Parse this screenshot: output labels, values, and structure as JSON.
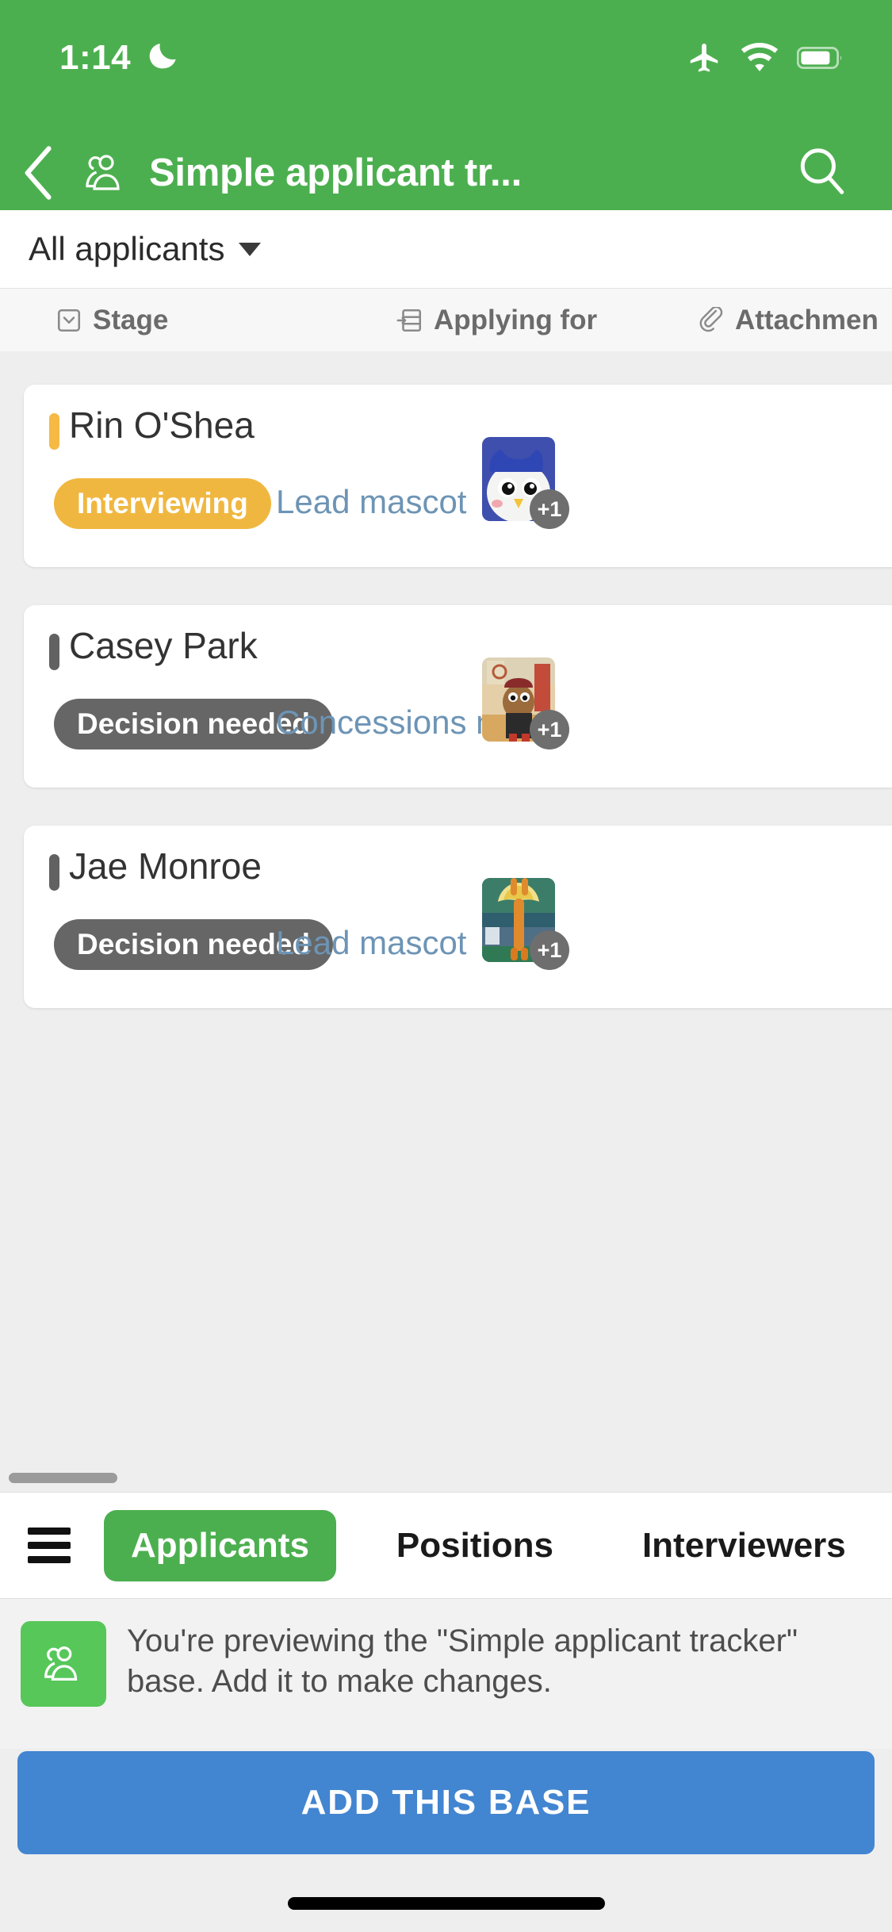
{
  "status_bar": {
    "time": "1:14",
    "icons": [
      "moon-icon",
      "airplane-mode-icon",
      "wifi-icon",
      "battery-icon"
    ]
  },
  "nav": {
    "back_label": "back-chevron",
    "base_icon": "people-icon",
    "title": "Simple applicant tr...",
    "search_icon": "search-icon"
  },
  "view_selector": {
    "label": "All applicants",
    "caret": "chevron-down-icon"
  },
  "fields": [
    {
      "label": "Stage",
      "icon": "single-select-icon"
    },
    {
      "label": "Applying for",
      "icon": "linked-record-icon"
    },
    {
      "label": "Attachmen",
      "icon": "paperclip-icon"
    }
  ],
  "records": [
    {
      "name": "Rin O'Shea",
      "color_bar": "#f5b944",
      "stage": "Interviewing",
      "stage_color": "#f0b740",
      "applying_for": "Lead mascot",
      "attachment_count": "+1"
    },
    {
      "name": "Casey Park",
      "color_bar": "#616161",
      "stage": "Decision needed",
      "stage_color": "#666666",
      "applying_for": "Concessions m...",
      "attachment_count": "+1"
    },
    {
      "name": "Jae Monroe",
      "color_bar": "#616161",
      "stage": "Decision needed",
      "stage_color": "#666666",
      "applying_for": "Lead mascot",
      "attachment_count": "+1"
    }
  ],
  "tabs": {
    "menu_icon": "hamburger-menu-icon",
    "items": [
      {
        "label": "Applicants",
        "active": true
      },
      {
        "label": "Positions",
        "active": false
      },
      {
        "label": "Interviewers",
        "active": false
      }
    ]
  },
  "banner": {
    "icon": "people-icon",
    "text": "You're previewing the \"Simple applicant tracker\" base. Add it to make changes."
  },
  "primary_button": {
    "label": "ADD THIS BASE"
  },
  "colors": {
    "brand_green": "#4caf4f",
    "link_blue": "#6d94b5",
    "button_blue": "#4285d1",
    "badge_yellow": "#f0b740",
    "badge_gray": "#666666",
    "page_bg": "#eeeeee"
  }
}
